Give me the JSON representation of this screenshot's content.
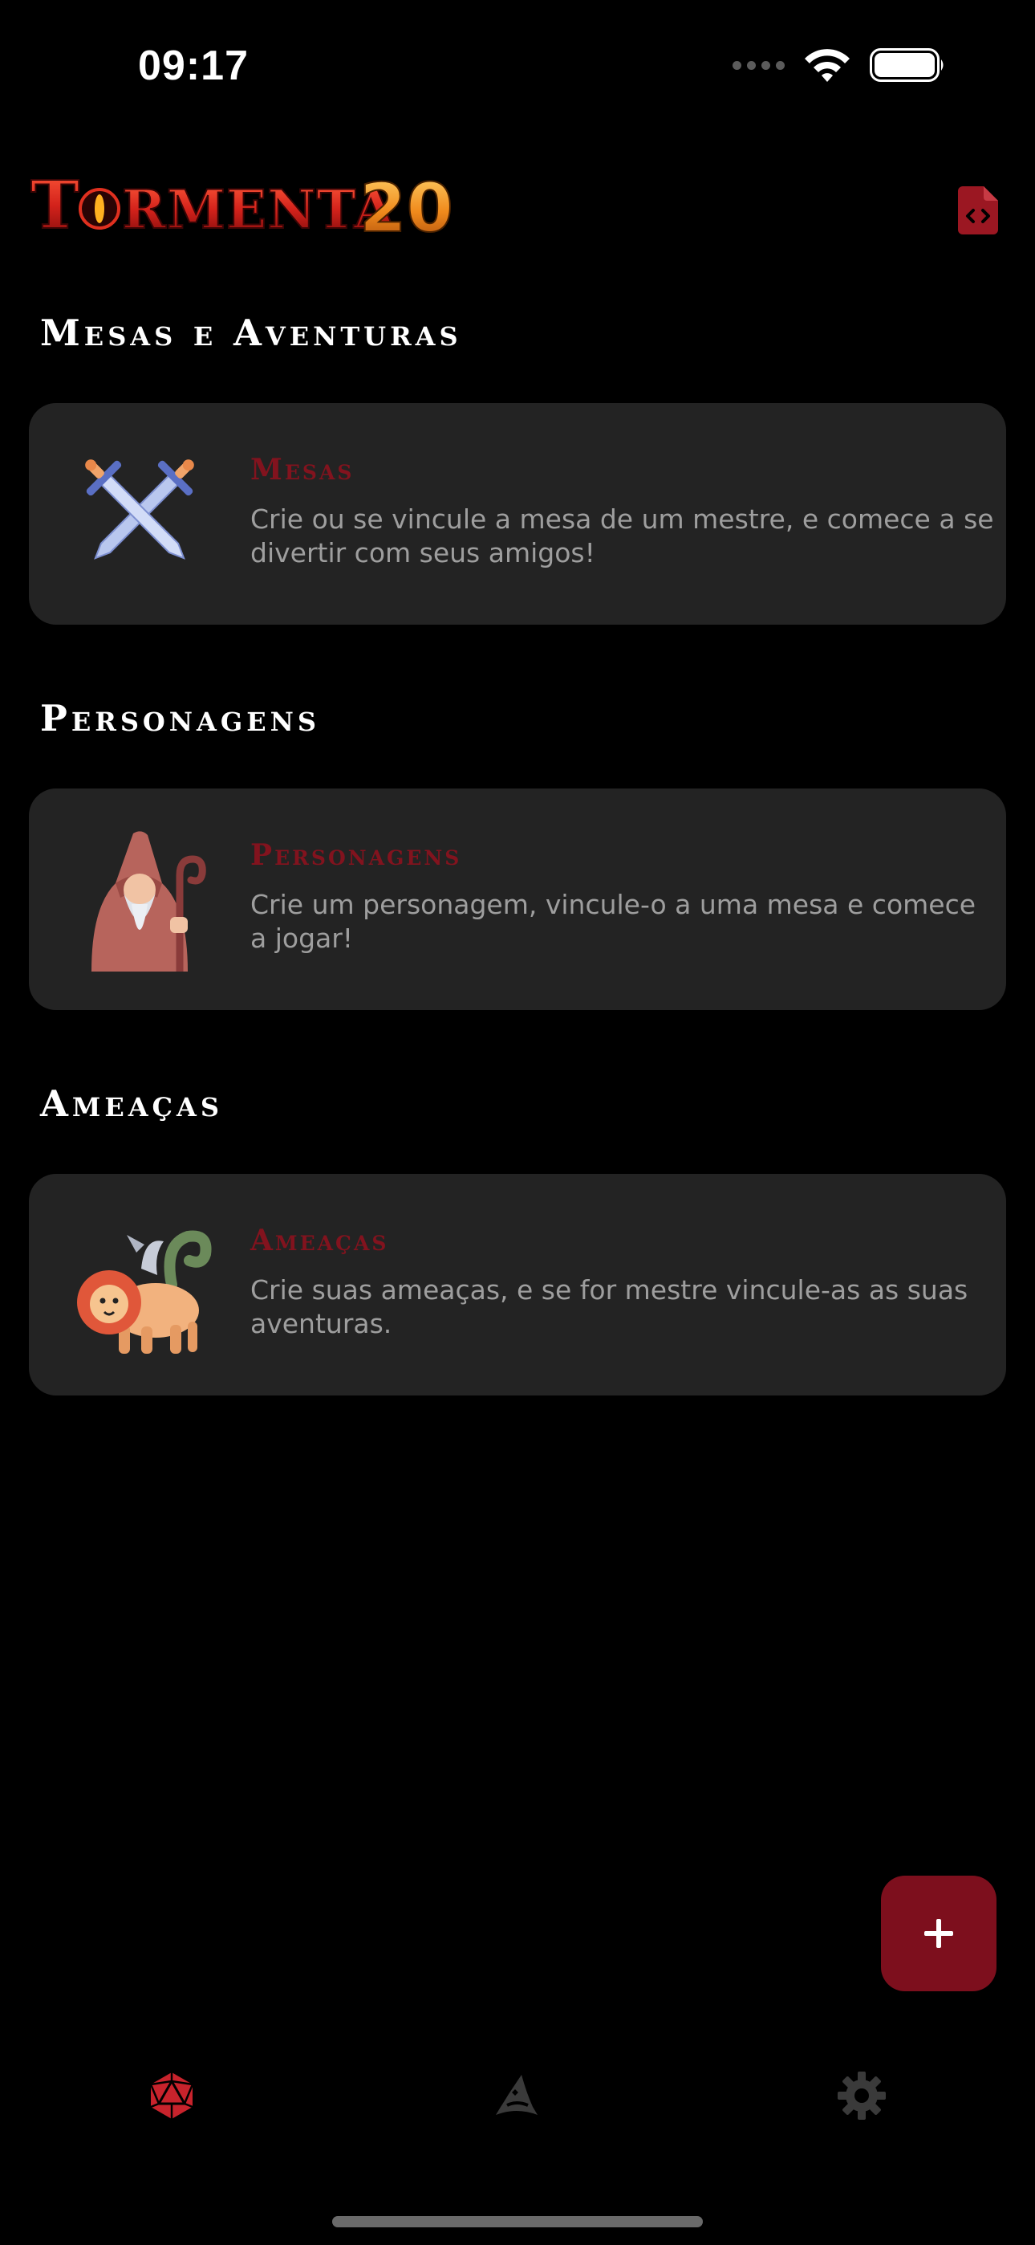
{
  "status_bar": {
    "time": "09:17",
    "icons": [
      "signal-dots-icon",
      "wifi-icon",
      "battery-icon"
    ]
  },
  "header": {
    "logo_text": "TORMENTA20",
    "logo_icon": "tormenta20-logo",
    "action_icon": "code-file-icon"
  },
  "sections": [
    {
      "heading": "Mesas e Aventuras",
      "card": {
        "icon": "crossed-swords-icon",
        "title": "Mesas",
        "description": "Crie ou se vincule a mesa de um mestre, e comece a se divertir com seus amigos!"
      }
    },
    {
      "heading": "Personagens",
      "card": {
        "icon": "wizard-icon",
        "title": "Personagens",
        "description": "Crie um personagem, vincule-o a uma mesa e comece a jogar!"
      }
    },
    {
      "heading": "Ameaças",
      "card": {
        "icon": "chimera-icon",
        "title": "Ameaças",
        "description": "Crie suas ameaças, e se for mestre vincule-as as suas aventuras."
      }
    }
  ],
  "fab": {
    "icon": "plus-icon"
  },
  "bottom_nav": {
    "items": [
      {
        "icon": "d20-dice-icon",
        "active": true
      },
      {
        "icon": "wizard-hat-icon",
        "active": false
      },
      {
        "icon": "gear-icon",
        "active": false
      }
    ]
  },
  "colors": {
    "background": "#000000",
    "card": "#232323",
    "accent": "#82131e",
    "fab": "#7d0f1d",
    "nav_active": "#c8232c",
    "nav_inactive": "#3a3a3a",
    "description": "#9e9e9e"
  }
}
